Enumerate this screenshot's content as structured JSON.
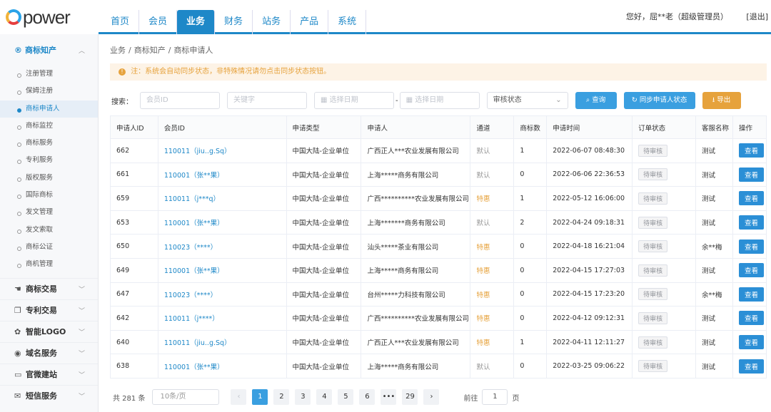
{
  "logo": {
    "text": "power"
  },
  "nav": {
    "tabs": [
      "首页",
      "会员",
      "业务",
      "财务",
      "站务",
      "产品",
      "系统"
    ],
    "active": 2,
    "user": "您好，屈**老（超级管理员）",
    "logout": "[退出]"
  },
  "sidebar": {
    "section": {
      "label": "商标知产",
      "icon": "registered-icon"
    },
    "items": [
      "注册管理",
      "保姆注册",
      "商标申请人",
      "商标监控",
      "商标服务",
      "专利服务",
      "版权服务",
      "国际商标",
      "发文管理",
      "发文索取",
      "商标公证",
      "商机管理"
    ],
    "active": 2,
    "groups": [
      {
        "label": "商标交易",
        "icon": "handshake-icon"
      },
      {
        "label": "专利交易",
        "icon": "copy-icon"
      },
      {
        "label": "智能LOGO",
        "icon": "palette-icon"
      },
      {
        "label": "域名服务",
        "icon": "globe-icon"
      },
      {
        "label": "官微建站",
        "icon": "monitor-icon"
      },
      {
        "label": "短信服务",
        "icon": "mail-icon"
      }
    ]
  },
  "breadcrumb": [
    "业务",
    "/",
    "商标知产",
    "/",
    "商标申请人"
  ],
  "notice": "注：系统会自动同步状态，非特殊情况请勿点击同步状态按钮。",
  "filters": {
    "label": "搜索：",
    "member_id": "会员ID",
    "keyword": "关键字",
    "date_start": "选择日期",
    "sep": "-",
    "date_end": "选择日期",
    "status": "审核状态",
    "query": "查询",
    "sync": "同步申请人状态",
    "export": "导出"
  },
  "table": {
    "headers": [
      "申请人ID",
      "会员ID",
      "申请类型",
      "申请人",
      "通道",
      "商标数",
      "申请时间",
      "订单状态",
      "客服名称",
      "操作"
    ],
    "rows": [
      [
        "662",
        "110011（jiu..g.Sq）",
        "中国大陆-企业单位",
        "广西正人***农业发展有限公司",
        "默认",
        "1",
        "2022-06-07 08:48:30",
        "待审核",
        "测试",
        "查看"
      ],
      [
        "661",
        "110001（张**果）",
        "中国大陆-企业单位",
        "上海*****商务有限公司",
        "默认",
        "0",
        "2022-06-06 22:36:53",
        "待审核",
        "测试",
        "查看"
      ],
      [
        "659",
        "110011（j***q）",
        "中国大陆-企业单位",
        "广西**********农业发展有限公司",
        "特惠",
        "1",
        "2022-05-12 16:06:00",
        "待审核",
        "测试",
        "查看"
      ],
      [
        "653",
        "110001（张**果）",
        "中国大陆-企业单位",
        "上海*******商务有限公司",
        "默认",
        "2",
        "2022-04-24 09:18:31",
        "待审核",
        "测试",
        "查看"
      ],
      [
        "650",
        "110023（****）",
        "中国大陆-企业单位",
        "汕头*****茶业有限公司",
        "特惠",
        "0",
        "2022-04-18 16:21:04",
        "待审核",
        "余**梅",
        "查看"
      ],
      [
        "649",
        "110001（张**果）",
        "中国大陆-企业单位",
        "上海*****商务有限公司",
        "特惠",
        "0",
        "2022-04-15 17:27:03",
        "待审核",
        "测试",
        "查看"
      ],
      [
        "647",
        "110023（****）",
        "中国大陆-企业单位",
        "台州*****力科技有限公司",
        "特惠",
        "0",
        "2022-04-15 17:23:20",
        "待审核",
        "余**梅",
        "查看"
      ],
      [
        "642",
        "110011（j****）",
        "中国大陆-企业单位",
        "广西**********农业发展有限公司",
        "特惠",
        "0",
        "2022-04-12 09:12:31",
        "待审核",
        "测试",
        "查看"
      ],
      [
        "640",
        "110011（jiu..g.Sq）",
        "中国大陆-企业单位",
        "广西正人***农业发展有限公司",
        "特惠",
        "1",
        "2022-04-11 12:11:27",
        "待审核",
        "测试",
        "查看"
      ],
      [
        "638",
        "110001（张**果）",
        "中国大陆-企业单位",
        "上海*****商务有限公司",
        "默认",
        "0",
        "2022-03-25 09:06:22",
        "待审核",
        "测试",
        "查看"
      ]
    ]
  },
  "pager": {
    "total": "共 281 条",
    "size": "10条/页",
    "prev": "‹",
    "pages": [
      "1",
      "2",
      "3",
      "4",
      "5",
      "6",
      "•••",
      "29"
    ],
    "active": 0,
    "next": "›",
    "goto": "前往",
    "goto_value": "1",
    "page_unit": "页"
  }
}
